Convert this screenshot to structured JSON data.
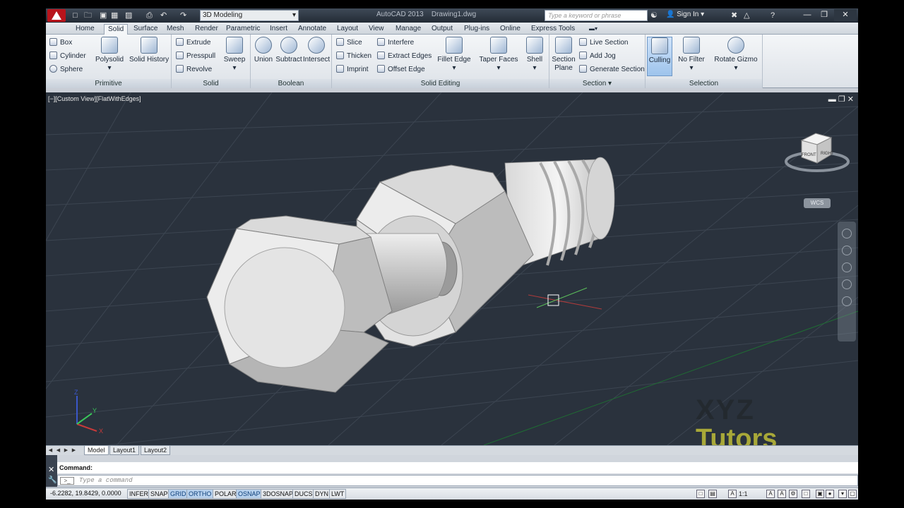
{
  "titlebar": {
    "workspace": "3D Modeling",
    "app_title": "AutoCAD 2013",
    "doc_title": "Drawing1.dwg",
    "search_placeholder": "Type a keyword or phrase",
    "sign_in": "Sign In",
    "help": "?"
  },
  "tabs": [
    "Home",
    "Solid",
    "Surface",
    "Mesh",
    "Render",
    "Parametric",
    "Insert",
    "Annotate",
    "Layout",
    "View",
    "Manage",
    "Output",
    "Plug-ins",
    "Online",
    "Express Tools"
  ],
  "ribbon": {
    "primitive": {
      "label": "Primitive",
      "box": "Box",
      "cylinder": "Cylinder",
      "sphere": "Sphere",
      "polysolid": "Polysolid",
      "solid_history": "Solid History"
    },
    "solid": {
      "label": "Solid",
      "extrude": "Extrude",
      "presspull": "Presspull",
      "revolve": "Revolve",
      "sweep": "Sweep"
    },
    "boolean": {
      "label": "Boolean",
      "union": "Union",
      "subtract": "Subtract",
      "intersect": "Intersect"
    },
    "solid_editing": {
      "label": "Solid Editing",
      "slice": "Slice",
      "thicken": "Thicken",
      "imprint": "Imprint",
      "interfere": "Interfere",
      "extract_edges": "Extract Edges",
      "offset_edge": "Offset Edge",
      "fillet_edge": "Fillet Edge",
      "taper_faces": "Taper Faces",
      "shell": "Shell"
    },
    "section": {
      "label": "Section",
      "section_plane_1": "Section",
      "section_plane_2": "Plane",
      "live_section": "Live Section",
      "add_jog": "Add Jog",
      "generate_section": "Generate Section"
    },
    "selection": {
      "label": "Selection",
      "culling": "Culling",
      "no_filter": "No Filter",
      "rotate_gizmo": "Rotate Gizmo"
    }
  },
  "viewport": {
    "label": "[−][Custom View][FlatWithEdges]",
    "viewcube_front": "FRONT",
    "viewcube_right": "RIGHT",
    "wcs": "WCS",
    "watermark_line1": "XYZ",
    "watermark_line2": "Tutors"
  },
  "layout_tabs": [
    "Model",
    "Layout1",
    "Layout2"
  ],
  "command": {
    "history": "Command:",
    "placeholder": "Type a command"
  },
  "status": {
    "coords": "-6.2282, 19.8429, 0.0000",
    "toggles": [
      {
        "label": "INFER",
        "on": false
      },
      {
        "label": "SNAP",
        "on": false
      },
      {
        "label": "GRID",
        "on": true
      },
      {
        "label": "ORTHO",
        "on": true
      },
      {
        "label": "POLAR",
        "on": false
      },
      {
        "label": "OSNAP",
        "on": true
      },
      {
        "label": "3DOSNAP",
        "on": false
      },
      {
        "label": "DUCS",
        "on": false
      },
      {
        "label": "DYN",
        "on": false
      },
      {
        "label": "LWT",
        "on": false
      }
    ],
    "scale": "1:1"
  }
}
